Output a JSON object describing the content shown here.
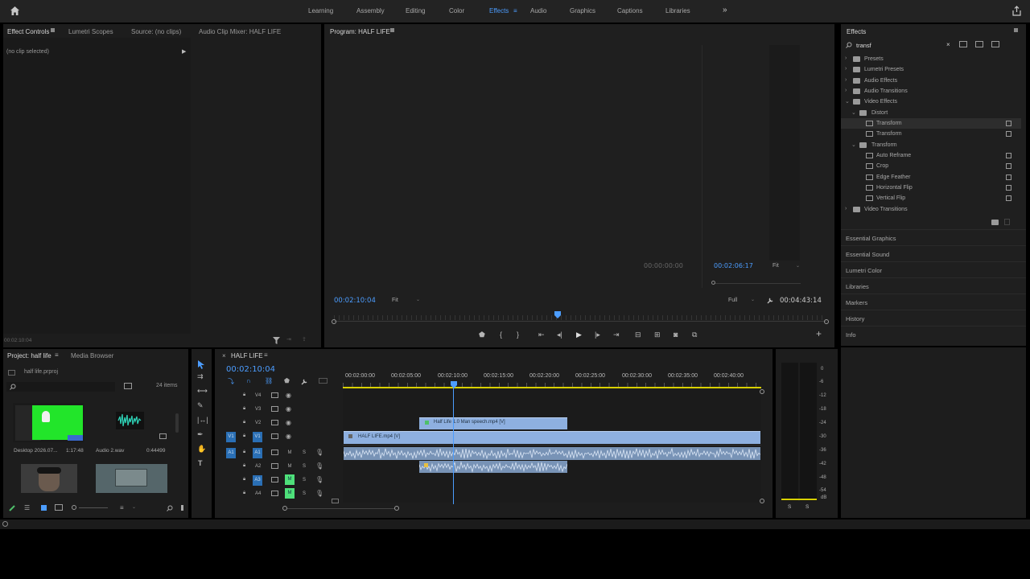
{
  "workspaces": [
    {
      "label": "Learning",
      "active": false
    },
    {
      "label": "Assembly",
      "active": false
    },
    {
      "label": "Editing",
      "active": false
    },
    {
      "label": "Color",
      "active": false
    },
    {
      "label": "Effects",
      "active": true
    },
    {
      "label": "Audio",
      "active": false
    },
    {
      "label": "Graphics",
      "active": false
    },
    {
      "label": "Captions",
      "active": false
    },
    {
      "label": "Libraries",
      "active": false
    }
  ],
  "source_panel": {
    "tabs": [
      "Effect Controls",
      "Lumetri Scopes",
      "Source: (no clips)",
      "Audio Clip Mixer: HALF LIFE"
    ],
    "no_clip": "(no clip selected)",
    "timecode": "00:02:10:04"
  },
  "program": {
    "tab": "Program: HALF LIFE",
    "timecode": "00:02:10:04",
    "fit": "Fit",
    "full": "Full",
    "duration": "00:04:43:14",
    "inner_start": "00:00:00:00",
    "inner_tc": "00:02:06:17",
    "inner_fit": "Fit"
  },
  "effects_panel": {
    "title": "Effects",
    "search": "transf",
    "tree": [
      {
        "label": "Presets",
        "level": 0,
        "type": "folder",
        "expanded": false
      },
      {
        "label": "Lumetri Presets",
        "level": 0,
        "type": "folder",
        "expanded": false
      },
      {
        "label": "Audio Effects",
        "level": 0,
        "type": "folder",
        "expanded": false
      },
      {
        "label": "Audio Transitions",
        "level": 0,
        "type": "folder",
        "expanded": false
      },
      {
        "label": "Video Effects",
        "level": 0,
        "type": "folder",
        "expanded": true
      },
      {
        "label": "Distort",
        "level": 1,
        "type": "folder",
        "expanded": true
      },
      {
        "label": "Transform",
        "level": 2,
        "type": "effect",
        "selected": true
      },
      {
        "label": "Transform",
        "level": 2,
        "type": "effect"
      },
      {
        "label": "Transform",
        "level": 1,
        "type": "folder",
        "expanded": true
      },
      {
        "label": "Auto Reframe",
        "level": 2,
        "type": "effect"
      },
      {
        "label": "Crop",
        "level": 2,
        "type": "effect"
      },
      {
        "label": "Edge Feather",
        "level": 2,
        "type": "effect"
      },
      {
        "label": "Horizontal Flip",
        "level": 2,
        "type": "effect"
      },
      {
        "label": "Vertical Flip",
        "level": 2,
        "type": "effect"
      },
      {
        "label": "Video Transitions",
        "level": 0,
        "type": "folder",
        "expanded": false
      }
    ],
    "side_panels": [
      "Essential Graphics",
      "Essential Sound",
      "Lumetri Color",
      "Libraries",
      "Markers",
      "History",
      "Info"
    ]
  },
  "project": {
    "tabs": [
      "Project: half life",
      "Media Browser"
    ],
    "file": "half life.prproj",
    "items_count": "24 items",
    "thumbs": [
      {
        "name": "Desktop 2026.07...",
        "duration": "1:17:48"
      },
      {
        "name": "Audio 2.wav",
        "duration": "0:44499"
      }
    ]
  },
  "timeline": {
    "tab": "HALF LIFE",
    "timecode": "00:02:10:04",
    "ruler": [
      "00:02:00:00",
      "00:02:05:00",
      "00:02:10:00",
      "00:02:15:00",
      "00:02:20:00",
      "00:02:25:00",
      "00:02:30:00",
      "00:02:35:00",
      "00:02:40:00"
    ],
    "video_tracks": [
      "V4",
      "V3",
      "V2",
      "V1"
    ],
    "audio_tracks": [
      "A1",
      "A2",
      "A3",
      "A4"
    ],
    "source_v": "V1",
    "source_a": "A1",
    "clips": {
      "v2": "Half Life 1.0 Man speech.mp4 [V]",
      "v1": "HALF LIFE.mp4 [V]"
    },
    "track_mute": "M",
    "track_solo": "S"
  },
  "meter": {
    "scale": [
      "0",
      "-6",
      "-12",
      "-18",
      "-24",
      "-30",
      "-36",
      "-42",
      "-48",
      "-54",
      "dB"
    ],
    "solo_labels": [
      "S",
      "S"
    ]
  }
}
